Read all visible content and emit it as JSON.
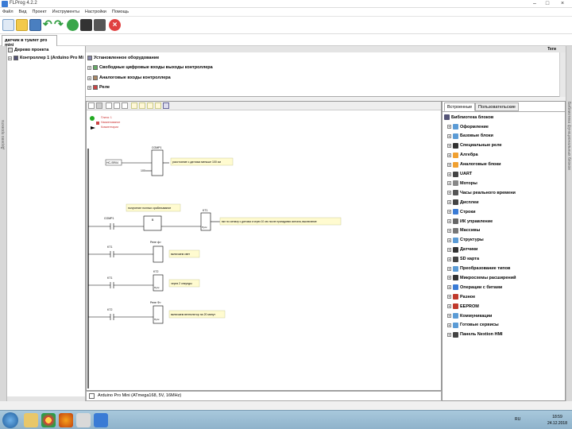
{
  "window": {
    "title": "FLProg 4.2.2"
  },
  "menu": [
    "Файл",
    "Вид",
    "Проект",
    "Инструменты",
    "Настройки",
    "Помощь"
  ],
  "doc_tab": "датчик в туалет pro mini",
  "project_tree": {
    "root": "Дерево проекта",
    "controller": "Контроллер 1 (Arduino Pro Mi"
  },
  "left_strip_label": "Дерево проекта",
  "right_strip_label": "Библиотека функциональных блоков",
  "hardware": {
    "header_right": "Теги",
    "items": [
      "Установленное оборудование",
      "Свободные цифровые входы выходы контроллера",
      "Аналоговые входы контроллера",
      "Реле"
    ]
  },
  "canvas": {
    "legend": [
      "Плата: 1",
      "Наименование",
      "Комментарии"
    ],
    "networks": [
      {
        "comp_name": "COMP1",
        "input_tag": "HC-SR04",
        "const": "100",
        "comment": "расстояние с датчика меньше 100 см"
      },
      {
        "contact": "COMP1",
        "block_label": "В",
        "timer_name": "KT1",
        "timer_type": "Пуск",
        "comment_top": "получение полных срабатывание",
        "comment_right": "вкл по сигналу с датчика и через 10 сек после пропадания сигнала, выключение"
      },
      {
        "contact": "KT1",
        "coil_label": "Реле ф>",
        "comment": "включаем свет"
      },
      {
        "contact": "KT1",
        "timer_name": "KT2",
        "timer_type": "Пуск",
        "comment": "через 2 секунды"
      },
      {
        "contact": "KT2",
        "coil_label": "Реле Ф>",
        "timer_type": "Пуск",
        "comment": "включаем вентилятор на 20 минут"
      }
    ]
  },
  "status": "Arduino Pro Mini (ATmega168, 5V, 16MHz)",
  "library": {
    "tabs": [
      "Встроенные",
      "Пользовательские"
    ],
    "root": "Библиотека блоков",
    "items": [
      {
        "label": "Оформление",
        "color": "#5b9bd5"
      },
      {
        "label": "Базовые блоки",
        "color": "#5b9bd5"
      },
      {
        "label": "Специальные реле",
        "color": "#333333"
      },
      {
        "label": "Алгебра",
        "color": "#f0a030"
      },
      {
        "label": "Аналоговые блоки",
        "color": "#f0a030"
      },
      {
        "label": "UART",
        "color": "#444444"
      },
      {
        "label": "Моторы",
        "color": "#888888"
      },
      {
        "label": "Часы реального времени",
        "color": "#555555"
      },
      {
        "label": "Дисплеи",
        "color": "#444444"
      },
      {
        "label": "Строки",
        "color": "#3a7bd5"
      },
      {
        "label": "ИК управление",
        "color": "#666666"
      },
      {
        "label": "Массивы",
        "color": "#777777"
      },
      {
        "label": "Структуры",
        "color": "#5b9bd5"
      },
      {
        "label": "Датчики",
        "color": "#333333"
      },
      {
        "label": "SD карта",
        "color": "#444444"
      },
      {
        "label": "Преобразование типов",
        "color": "#5b9bd5"
      },
      {
        "label": "Микросхемы расширений",
        "color": "#333333"
      },
      {
        "label": "Операции с битами",
        "color": "#3a7bd5"
      },
      {
        "label": "Разное",
        "color": "#c0392b"
      },
      {
        "label": "EEPROM",
        "color": "#c0392b"
      },
      {
        "label": "Коммуникации",
        "color": "#5b9bd5"
      },
      {
        "label": "Готовые сервисы",
        "color": "#5b9bd5"
      },
      {
        "label": "Панель Nextion HMI",
        "color": "#444444"
      }
    ]
  },
  "clock": {
    "time": "18:59",
    "date": "24.12.2018",
    "lang": "RU"
  }
}
